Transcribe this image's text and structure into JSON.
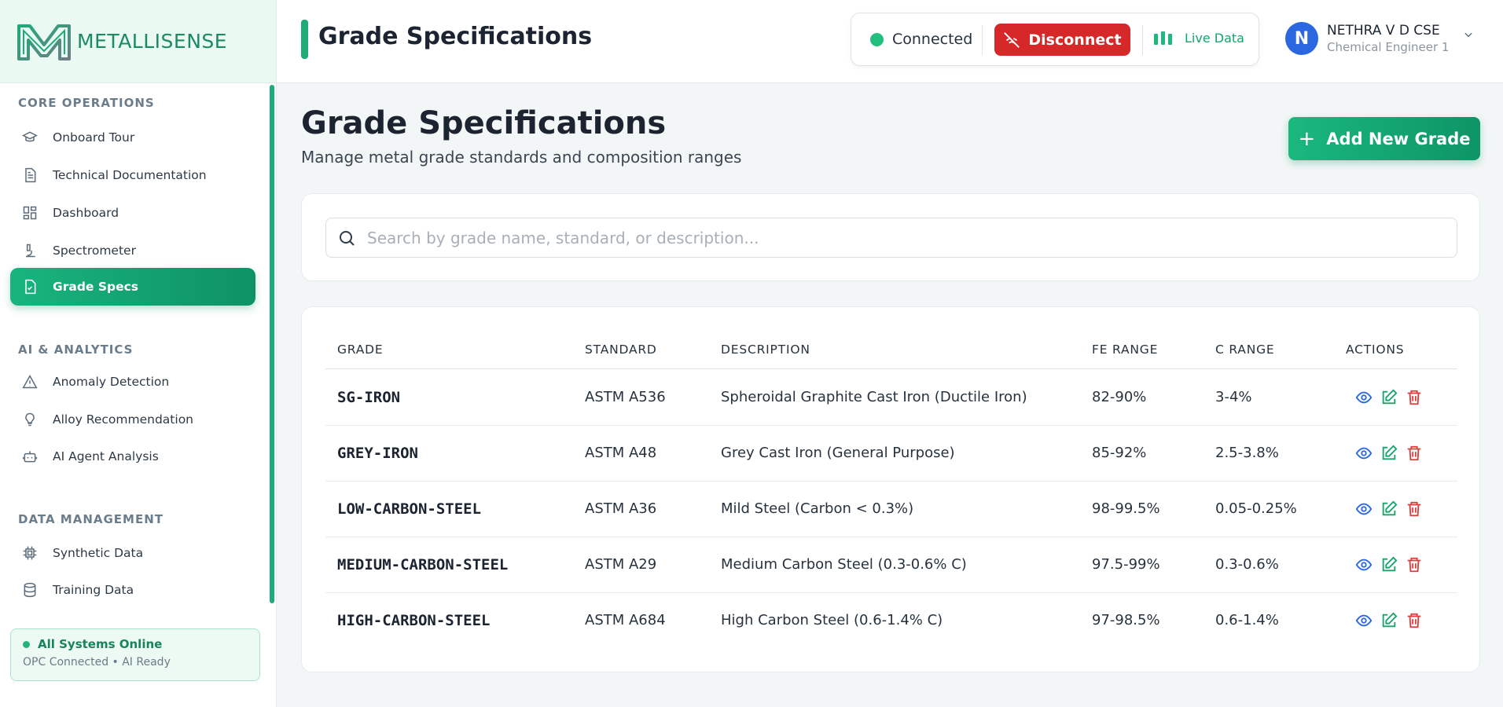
{
  "brand": {
    "name": "METALLISENSE"
  },
  "sidebar": {
    "sections": [
      {
        "title": "CORE OPERATIONS"
      },
      {
        "title": "AI & ANALYTICS"
      },
      {
        "title": "DATA MANAGEMENT"
      }
    ],
    "items": [
      {
        "label": "Onboard Tour",
        "icon": "graduation-cap-icon"
      },
      {
        "label": "Technical Documentation",
        "icon": "document-icon"
      },
      {
        "label": "Dashboard",
        "icon": "dashboard-icon"
      },
      {
        "label": "Spectrometer",
        "icon": "microscope-icon"
      },
      {
        "label": "Grade Specs",
        "icon": "file-check-icon",
        "active": true
      },
      {
        "label": "Anomaly Detection",
        "icon": "warning-triangle-icon"
      },
      {
        "label": "Alloy Recommendation",
        "icon": "lightbulb-icon"
      },
      {
        "label": "AI Agent Analysis",
        "icon": "robot-icon"
      },
      {
        "label": "Synthetic Data",
        "icon": "cpu-chip-icon"
      },
      {
        "label": "Training Data",
        "icon": "database-icon"
      }
    ],
    "status": {
      "title": "All Systems Online",
      "detail": "OPC Connected • AI Ready"
    }
  },
  "header": {
    "title": "Grade Specifications",
    "connection": {
      "status": "Connected",
      "disconnect_label": "Disconnect",
      "live_label": "Live Data"
    },
    "user": {
      "initial": "N",
      "name": "NETHRA V D CSE",
      "role": "Chemical Engineer 1"
    }
  },
  "main": {
    "title": "Grade Specifications",
    "subtitle": "Manage metal grade standards and composition ranges",
    "add_label": "Add New Grade",
    "search": {
      "placeholder": "Search by grade name, standard, or description..."
    },
    "table": {
      "columns": [
        "GRADE",
        "STANDARD",
        "DESCRIPTION",
        "FE RANGE",
        "C RANGE",
        "ACTIONS"
      ],
      "rows": [
        {
          "grade": "SG-IRON",
          "standard": "ASTM A536",
          "description": "Spheroidal Graphite Cast Iron (Ductile Iron)",
          "fe": "82-90%",
          "c": "3-4%"
        },
        {
          "grade": "GREY-IRON",
          "standard": "ASTM A48",
          "description": "Grey Cast Iron (General Purpose)",
          "fe": "85-92%",
          "c": "2.5-3.8%"
        },
        {
          "grade": "LOW-CARBON-STEEL",
          "standard": "ASTM A36",
          "description": "Mild Steel (Carbon < 0.3%)",
          "fe": "98-99.5%",
          "c": "0.05-0.25%"
        },
        {
          "grade": "MEDIUM-CARBON-STEEL",
          "standard": "ASTM A29",
          "description": "Medium Carbon Steel (0.3-0.6% C)",
          "fe": "97.5-99%",
          "c": "0.3-0.6%"
        },
        {
          "grade": "HIGH-CARBON-STEEL",
          "standard": "ASTM A684",
          "description": "High Carbon Steel (0.6-1.4% C)",
          "fe": "97-98.5%",
          "c": "0.6-1.4%"
        }
      ]
    }
  },
  "colors": {
    "accent": "#1dab78",
    "danger": "#d62828",
    "view": "#2a67e0",
    "edit": "#17a36a",
    "delete": "#e03b3b"
  }
}
